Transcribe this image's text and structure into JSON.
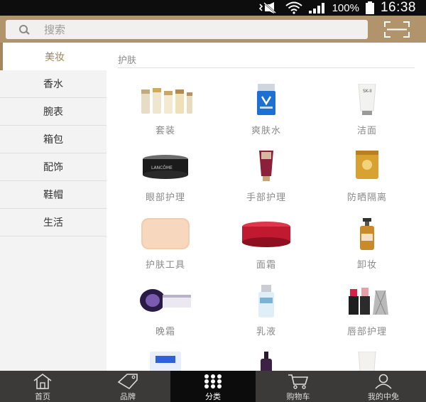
{
  "status_bar": {
    "battery": "100%",
    "time": "16:38",
    "icons": [
      "mute-vibrate-icon",
      "wifi-icon",
      "signal-icon",
      "battery-icon"
    ]
  },
  "search": {
    "placeholder": "搜索",
    "icon": "search-icon",
    "scan_icon": "scan-icon"
  },
  "sidebar": {
    "items": [
      {
        "label": "美妆",
        "active": true
      },
      {
        "label": "香水"
      },
      {
        "label": "腕表"
      },
      {
        "label": "箱包"
      },
      {
        "label": "配饰"
      },
      {
        "label": "鞋帽"
      },
      {
        "label": "生活"
      }
    ]
  },
  "main": {
    "section_title": "护肤",
    "products": [
      {
        "label": "套装"
      },
      {
        "label": "爽肤水"
      },
      {
        "label": "洁面"
      },
      {
        "label": "眼部护理"
      },
      {
        "label": "手部护理"
      },
      {
        "label": "防晒隔离"
      },
      {
        "label": "护肤工具"
      },
      {
        "label": "面霜"
      },
      {
        "label": "卸妆"
      },
      {
        "label": "晚霜"
      },
      {
        "label": "乳液"
      },
      {
        "label": "唇部护理"
      }
    ]
  },
  "nav": {
    "items": [
      {
        "label": "首页",
        "icon": "home-icon"
      },
      {
        "label": "品牌",
        "icon": "tag-icon"
      },
      {
        "label": "分类",
        "icon": "grid-dots-icon",
        "active": true
      },
      {
        "label": "购物车",
        "icon": "cart-icon"
      },
      {
        "label": "我的中免",
        "icon": "user-icon"
      }
    ]
  },
  "colors": {
    "accent": "#b2946c",
    "active_text": "#a3865c",
    "nav_bg": "#3b3a38",
    "nav_active_bg": "#0c0c0c"
  }
}
